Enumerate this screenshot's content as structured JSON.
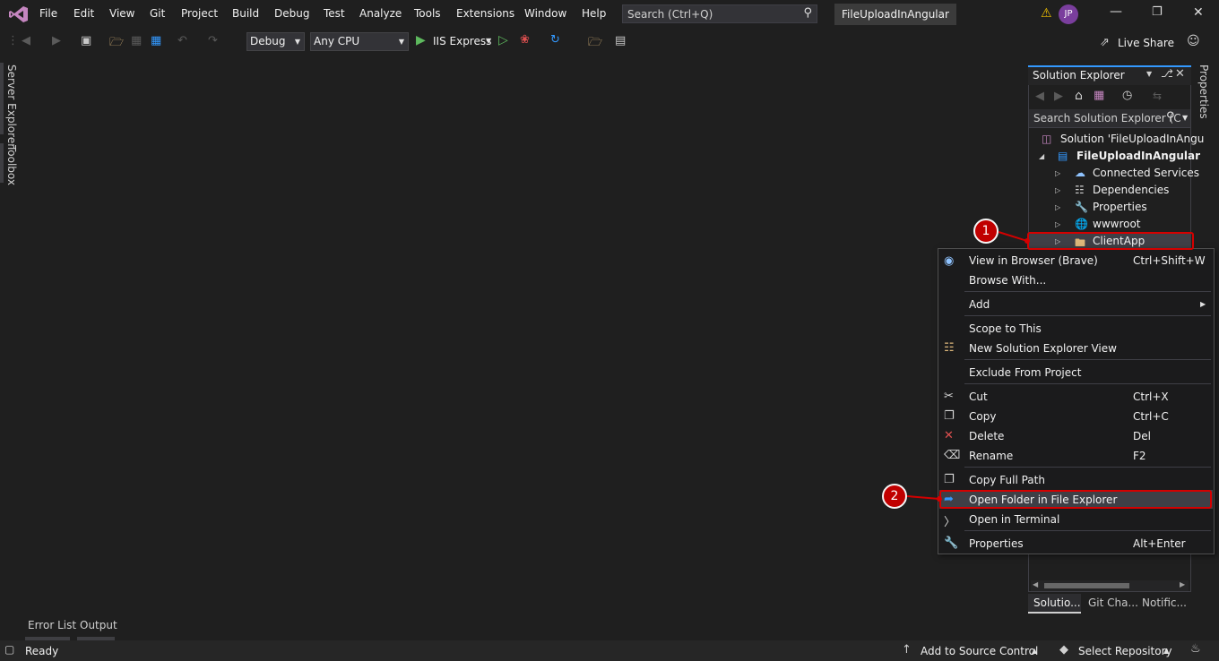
{
  "app": {
    "project_title": "FileUploadInAngular",
    "user_initials": "JP",
    "search_placeholder": "Search (Ctrl+Q)",
    "live_share": "Live Share"
  },
  "menu": [
    "File",
    "Edit",
    "View",
    "Git",
    "Project",
    "Build",
    "Debug",
    "Test",
    "Analyze",
    "Tools",
    "Extensions",
    "Window",
    "Help"
  ],
  "toolbar": {
    "config": "Debug",
    "platform": "Any CPU",
    "run_target": "IIS Express"
  },
  "left_strip": {
    "server_explorer": "Server Explorer",
    "toolbox": "Toolbox"
  },
  "right_strip": {
    "properties": "Properties"
  },
  "solution_explorer": {
    "title": "Solution Explorer",
    "search_placeholder": "Search Solution Explorer (C",
    "items": [
      {
        "label": "Solution 'FileUploadInAngu",
        "icon": "solution-icon"
      },
      {
        "label": "FileUploadInAngular",
        "icon": "web-project-icon"
      },
      {
        "label": "Connected Services",
        "icon": "connected-services-icon"
      },
      {
        "label": "Dependencies",
        "icon": "dependencies-icon"
      },
      {
        "label": "Properties",
        "icon": "properties-folder-icon"
      },
      {
        "label": "wwwroot",
        "icon": "globe-icon"
      },
      {
        "label": "ClientApp",
        "icon": "folder-icon"
      }
    ],
    "bottom_tabs": [
      "Solutio...",
      "Git Cha...",
      "Notific..."
    ]
  },
  "context_menu": {
    "items": [
      {
        "label": "View in Browser (Brave)",
        "shortcut": "Ctrl+Shift+W"
      },
      {
        "label": "Browse With...",
        "shortcut": ""
      },
      {
        "label": "Add",
        "shortcut": ""
      },
      {
        "label": "Scope to This",
        "shortcut": ""
      },
      {
        "label": "New Solution Explorer View",
        "shortcut": ""
      },
      {
        "label": "Exclude From Project",
        "shortcut": ""
      },
      {
        "label": "Cut",
        "shortcut": "Ctrl+X"
      },
      {
        "label": "Copy",
        "shortcut": "Ctrl+C"
      },
      {
        "label": "Delete",
        "shortcut": "Del"
      },
      {
        "label": "Rename",
        "shortcut": "F2"
      },
      {
        "label": "Copy Full Path",
        "shortcut": ""
      },
      {
        "label": "Open Folder in File Explorer",
        "shortcut": ""
      },
      {
        "label": "Open in Terminal",
        "shortcut": ""
      },
      {
        "label": "Properties",
        "shortcut": "Alt+Enter"
      }
    ]
  },
  "callouts": [
    "1",
    "2"
  ],
  "bottom_tabs": [
    "Error List",
    "Output"
  ],
  "status_bar": {
    "ready": "Ready",
    "add_source_control": "Add to Source Control",
    "select_repository": "Select Repository"
  },
  "colors": {
    "accent": "#3399ff",
    "highlight_red": "#d40000",
    "badge_red": "#c00000",
    "run_green": "#5eb95e",
    "vs_purple": "#c586c0"
  }
}
